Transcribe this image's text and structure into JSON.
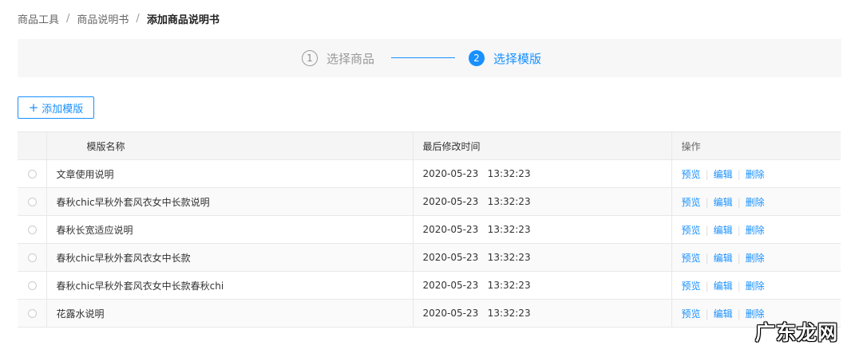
{
  "breadcrumb": {
    "items": [
      "商品工具",
      "商品说明书"
    ],
    "separator": "/",
    "current": "添加商品说明书"
  },
  "steps": [
    {
      "num": "1",
      "label": "选择商品",
      "state": "done"
    },
    {
      "num": "2",
      "label": "选择模版",
      "state": "active"
    }
  ],
  "toolbar": {
    "add_label": "添加模版",
    "add_icon": "plus-icon"
  },
  "table": {
    "headers": {
      "name": "模版名称",
      "time": "最后修改时间",
      "ops": "操作"
    },
    "ops": {
      "preview": "预览",
      "edit": "编辑",
      "delete": "删除",
      "separator": "|"
    },
    "rows": [
      {
        "name": "文章使用说明",
        "time": "2020-05-23   13:32:23"
      },
      {
        "name": "春秋chic早秋外套风衣女中长款说明",
        "time": "2020-05-23   13:32:23"
      },
      {
        "name": "春秋长宽适应说明",
        "time": "2020-05-23   13:32:23"
      },
      {
        "name": "春秋chic早秋外套风衣女中长款",
        "time": "2020-05-23   13:32:23"
      },
      {
        "name": "春秋chic早秋外套风衣女中长款春秋chi",
        "time": "2020-05-23   13:32:23"
      },
      {
        "name": "花露水说明",
        "time": "2020-05-23   13:32:23"
      }
    ]
  },
  "watermark": "广东龙网",
  "colors": {
    "accent": "#1890ff",
    "header_bg": "#f5f5f5",
    "steps_bg": "#f7f7f8"
  }
}
